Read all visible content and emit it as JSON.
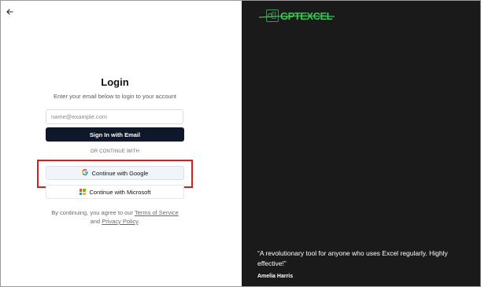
{
  "login": {
    "title": "Login",
    "subtitle": "Enter your email below to login to your account",
    "email_placeholder": "name@example.com",
    "email_value": "",
    "signin_label": "Sign In with Email",
    "divider": "OR CONTINUE WITH",
    "google_label": "Continue with Google",
    "microsoft_label": "Continue with Microsoft",
    "terms_prefix": "By continuing, you agree to our ",
    "terms_link": "Terms of Service",
    "terms_and": " and ",
    "privacy_link": "Privacy Policy",
    "terms_suffix": "."
  },
  "brand": {
    "name": "GPTEXCEL",
    "accent": "#3ec15a"
  },
  "testimonial": {
    "quote": "“A revolutionary tool for anyone who uses Excel regularly. Highly effective!”",
    "author": "Amelia Harris"
  },
  "icons": {
    "back": "arrow-left-icon",
    "google": "google-icon",
    "microsoft": "microsoft-icon",
    "logo": "excel-logo-icon"
  },
  "colors": {
    "primary_button": "#0f172a",
    "right_panel_bg": "#1a1a1a",
    "highlight": "#d21f1f"
  }
}
